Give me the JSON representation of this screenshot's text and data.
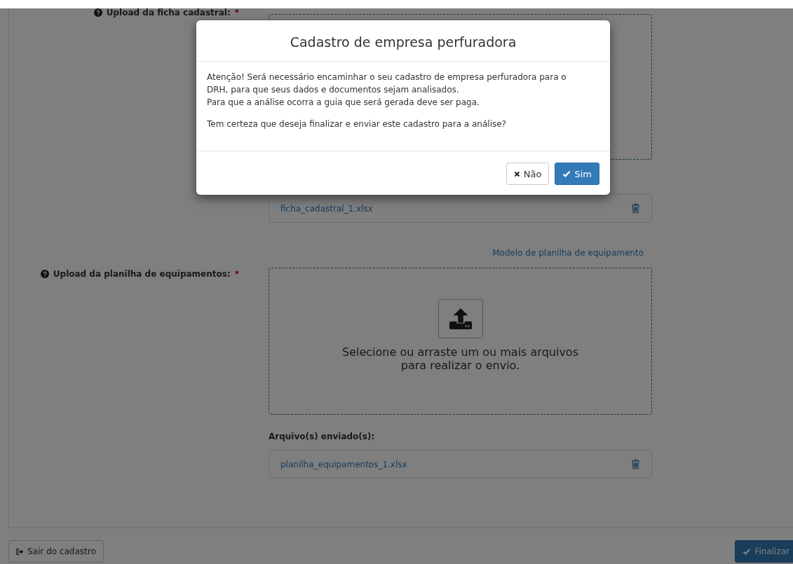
{
  "sections": [
    {
      "label": "Upload da ficha cadastral:",
      "required_mark": "*",
      "files": [
        "ficha_cadastral_1.xlsx"
      ]
    },
    {
      "template_link": "Modelo de planilha de equipamento",
      "label": "Upload da planilha de equipamentos:",
      "required_mark": "*",
      "dropzone_text": "Selecione ou arraste um ou mais arquivos para realizar o envio.",
      "files_label": "Arquivo(s) enviado(s):",
      "files": [
        "planilha_equipamentos_1.xlsx"
      ]
    }
  ],
  "footer": {
    "exit_button": "Sair do cadastro",
    "finish_button": "Finalizar"
  },
  "modal": {
    "title": "Cadastro de empresa perfuradora",
    "paragraphs": [
      {
        "lines": [
          "Atenção! Será necessário encaminhar o seu cadastro de empresa perfuradora para o DRH, para que seus dados e documentos sejam analisados.",
          "Para que a análise ocorra a guia que será gerada deve ser paga."
        ]
      },
      {
        "lines": [
          "Tem certeza que deseja finalizar e enviar este cadastro para a análise?"
        ]
      }
    ],
    "buttons": [
      {
        "label": "Não",
        "kind": "cancel"
      },
      {
        "label": "Sim",
        "kind": "confirm"
      }
    ]
  }
}
